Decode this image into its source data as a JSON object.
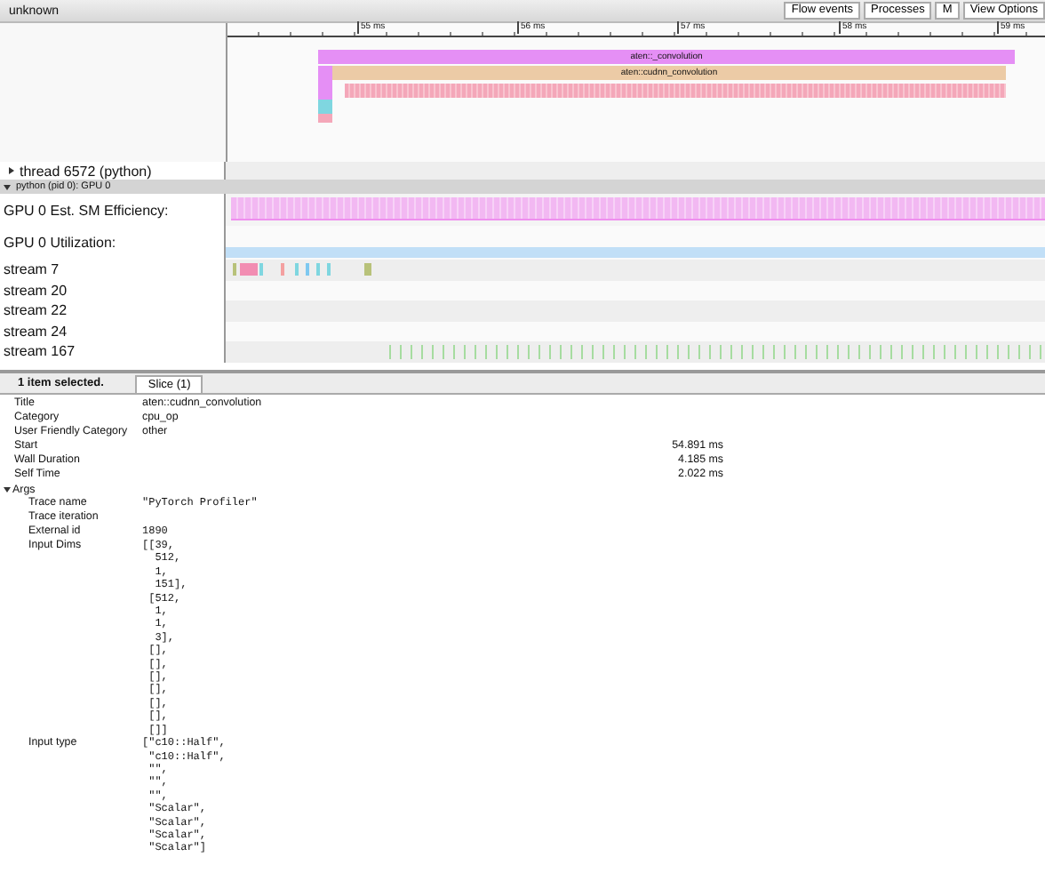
{
  "window": {
    "title": "unknown"
  },
  "toolbar": {
    "buttons": [
      {
        "label": "Flow events"
      },
      {
        "label": "Processes"
      },
      {
        "label": "M"
      },
      {
        "label": "View Options"
      }
    ]
  },
  "ruler": {
    "ticks": [
      "55 ms",
      "56 ms",
      "57 ms",
      "58 ms",
      "59 ms"
    ]
  },
  "slices": [
    {
      "label": "aten::_convolution",
      "color": "#e58ff5"
    },
    {
      "label": "aten::cudnn_convolution",
      "color": "#eccba6"
    }
  ],
  "tracks": [
    {
      "kind": "thread",
      "label": "thread 6572 (python)",
      "expanded": false
    },
    {
      "kind": "process",
      "label": "python (pid 0): GPU 0",
      "expanded": true
    },
    {
      "kind": "sm-efficiency",
      "label": "GPU 0 Est. SM Efficiency:"
    },
    {
      "kind": "utilization",
      "label": "GPU 0 Utilization:"
    },
    {
      "kind": "stream-kernels",
      "label": "stream 7"
    },
    {
      "kind": "stream",
      "label": "stream 20"
    },
    {
      "kind": "stream",
      "label": "stream 22"
    },
    {
      "kind": "stream",
      "label": "stream 24"
    },
    {
      "kind": "stream-ticks",
      "label": "stream 167"
    }
  ],
  "details": {
    "selection": "1 item selected.",
    "tabs": [
      {
        "label": "Slice (1)",
        "selected": true
      }
    ],
    "rows": [
      {
        "kind": "text",
        "label": "Title",
        "value": "aten::cudnn_convolution"
      },
      {
        "kind": "text",
        "label": "Category",
        "value": "cpu_op"
      },
      {
        "kind": "text",
        "label": "User Friendly Category",
        "value": "other"
      },
      {
        "kind": "number",
        "label": "Start",
        "value": "54.891 ms"
      },
      {
        "kind": "number",
        "label": "Wall Duration",
        "value": "4.185 ms"
      },
      {
        "kind": "number",
        "label": "Self Time",
        "value": "2.022 ms"
      }
    ],
    "args": {
      "label": "Args",
      "expanded": true,
      "rows": [
        {
          "label": "Trace name",
          "lines": [
            "\"PyTorch Profiler\""
          ]
        },
        {
          "label": "Trace iteration",
          "lines": []
        },
        {
          "label": "External id",
          "lines": [
            "1890"
          ]
        },
        {
          "label": "Input Dims",
          "lines": [
            "[[39,",
            "  512,",
            "  1,",
            "  151],",
            " [512,",
            "  1,",
            "  1,",
            "  3],",
            " [],",
            " [],",
            " [],",
            " [],",
            " [],",
            " [],",
            " []]"
          ]
        },
        {
          "label": "Input type",
          "lines": [
            "[\"c10::Half\",",
            " \"c10::Half\",",
            " \"\",",
            " \"\",",
            " \"\",",
            " \"Scalar\",",
            " \"Scalar\",",
            " \"Scalar\",",
            " \"Scalar\"]"
          ]
        }
      ]
    }
  }
}
